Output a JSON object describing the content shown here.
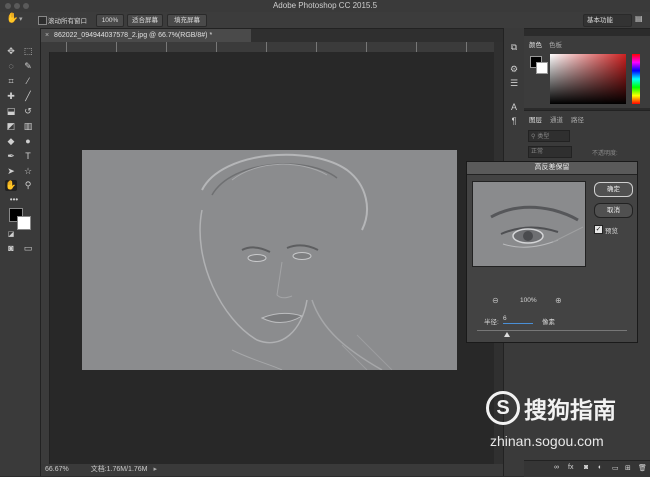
{
  "titlebar": {
    "title": "Adobe Photoshop CC 2015.5"
  },
  "options": {
    "scroll_all_label": "滚动所有窗口",
    "zoom_100": "100%",
    "fit_screen": "适合屏幕",
    "fill_screen": "填充屏幕",
    "workspace": "基本功能"
  },
  "document": {
    "tab_label": "862022_094944037578_2.jpg @ 66.7%(RGB/8#) *"
  },
  "status": {
    "zoom": "66.67%",
    "doc_size": "文档:1.76M/1.76M"
  },
  "panels": {
    "color_tab": "颜色",
    "swatches_tab": "色板",
    "layers_tab": "图层",
    "channels_tab": "通道",
    "paths_tab": "路径",
    "kind_label": "类型",
    "blend_mode": "正常",
    "opacity_label": "不透明度:"
  },
  "dialog": {
    "title": "高反差保留",
    "ok": "确定",
    "cancel": "取消",
    "preview_label": "预览",
    "preview_checked": true,
    "zoom_level": "100%",
    "radius_label": "半径:",
    "radius_value": "6",
    "unit": "像素"
  },
  "watermark": {
    "brand": "搜狗指南",
    "url": "zhinan.sogou.com"
  },
  "colors": {
    "accent": "#cc2020",
    "ui_dark": "#2b2b2b",
    "photo_gray": "#8b8c8e"
  }
}
